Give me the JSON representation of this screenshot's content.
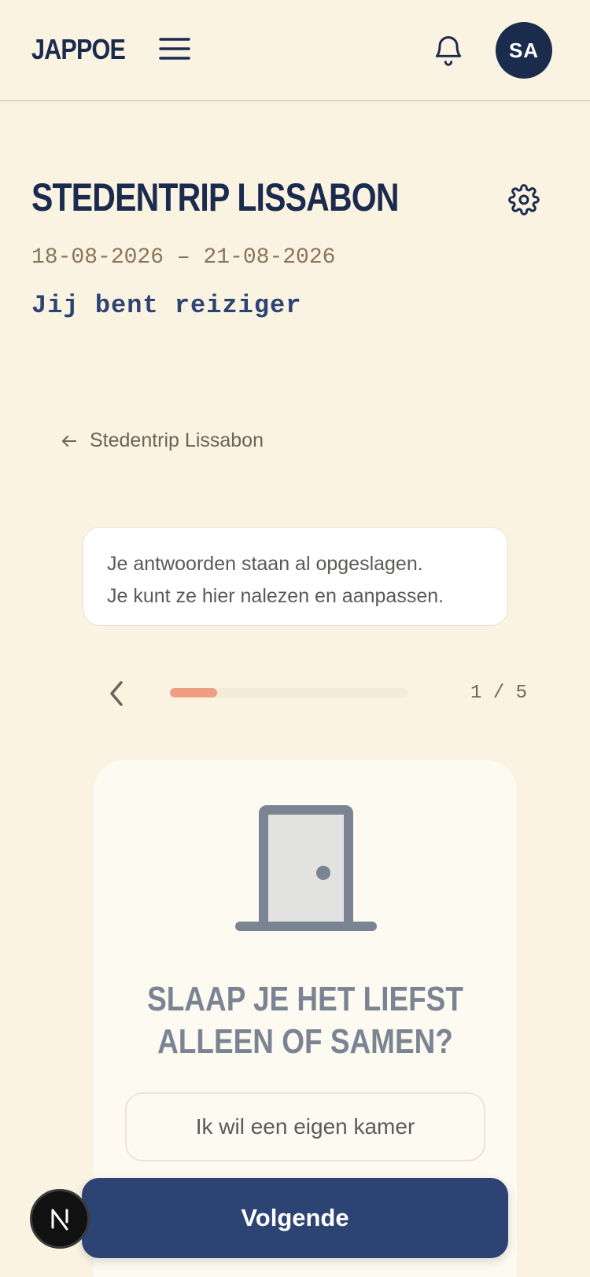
{
  "header": {
    "logo": "JAPPOE",
    "avatar_initials": "SA",
    "menu_icon": "hamburger-icon",
    "bell_icon": "bell-icon"
  },
  "trip": {
    "title": "STEDENTRIP LISSABON",
    "dates": "18-08-2026 – 21-08-2026",
    "role": "Jij bent reiziger",
    "settings_icon": "gear-icon"
  },
  "back_link": {
    "label": "Stedentrip Lissabon",
    "icon": "arrow-left-icon"
  },
  "info": {
    "line1": "Je antwoorden staan al opgeslagen.",
    "line2": "Je kunt ze hier nalezen en aanpassen."
  },
  "progress": {
    "current": 1,
    "total": 5,
    "label": "1 / 5",
    "fill_fraction": 0.2
  },
  "question": {
    "icon": "door-icon",
    "text": "SLAAP JE HET LIEFST ALLEEN OF SAMEN?",
    "options": [
      "Ik wil een eigen kamer"
    ]
  },
  "footer": {
    "next_label": "Volgende",
    "dev_badge": "N"
  },
  "colors": {
    "background": "#faf3e2",
    "navy": "#1b2b4d",
    "button": "#2d4373",
    "progress": "#ef9e84"
  }
}
